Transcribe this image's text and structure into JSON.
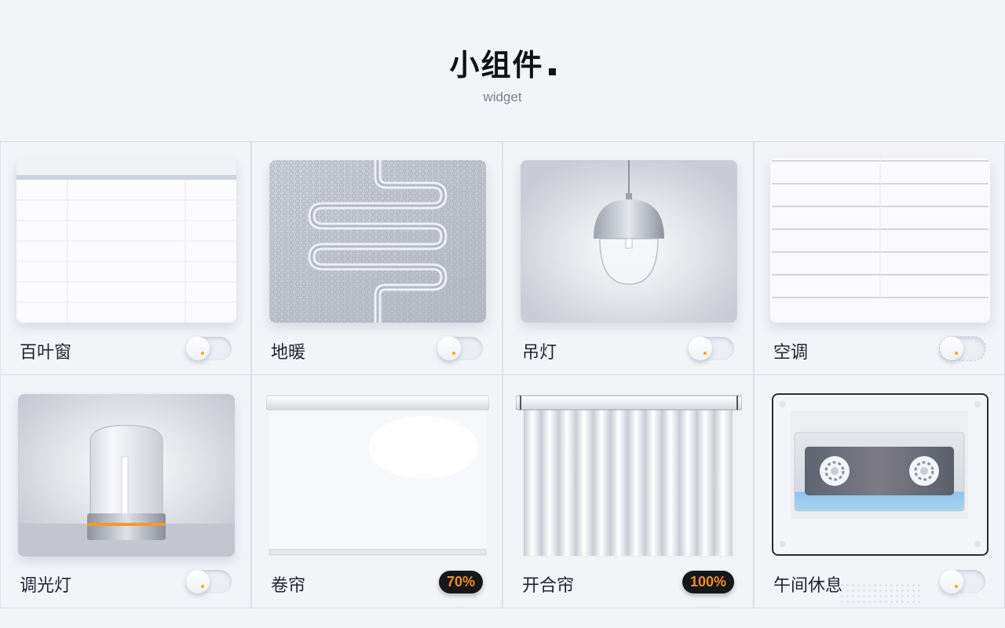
{
  "header": {
    "title": "小组件",
    "subtitle": "widget"
  },
  "widgets": [
    {
      "label": "百叶窗",
      "control": "toggle",
      "icon": "blinds-icon"
    },
    {
      "label": "地暖",
      "control": "toggle",
      "icon": "floor-heating-icon"
    },
    {
      "label": "吊灯",
      "control": "toggle",
      "icon": "pendant-lamp-icon"
    },
    {
      "label": "空调",
      "control": "toggle",
      "icon": "air-conditioner-icon"
    },
    {
      "label": "调光灯",
      "control": "toggle",
      "icon": "dimmer-lamp-icon"
    },
    {
      "label": "卷帘",
      "control": "percent",
      "value": "70%",
      "icon": "roller-blind-icon"
    },
    {
      "label": "开合帘",
      "control": "percent",
      "value": "100%",
      "icon": "curtain-icon"
    },
    {
      "label": "午间休息",
      "control": "toggle",
      "icon": "cassette-icon"
    }
  ],
  "colors": {
    "accent": "#f28c28",
    "knob_dot": "#f5a623",
    "background": "#f3f4f8"
  }
}
